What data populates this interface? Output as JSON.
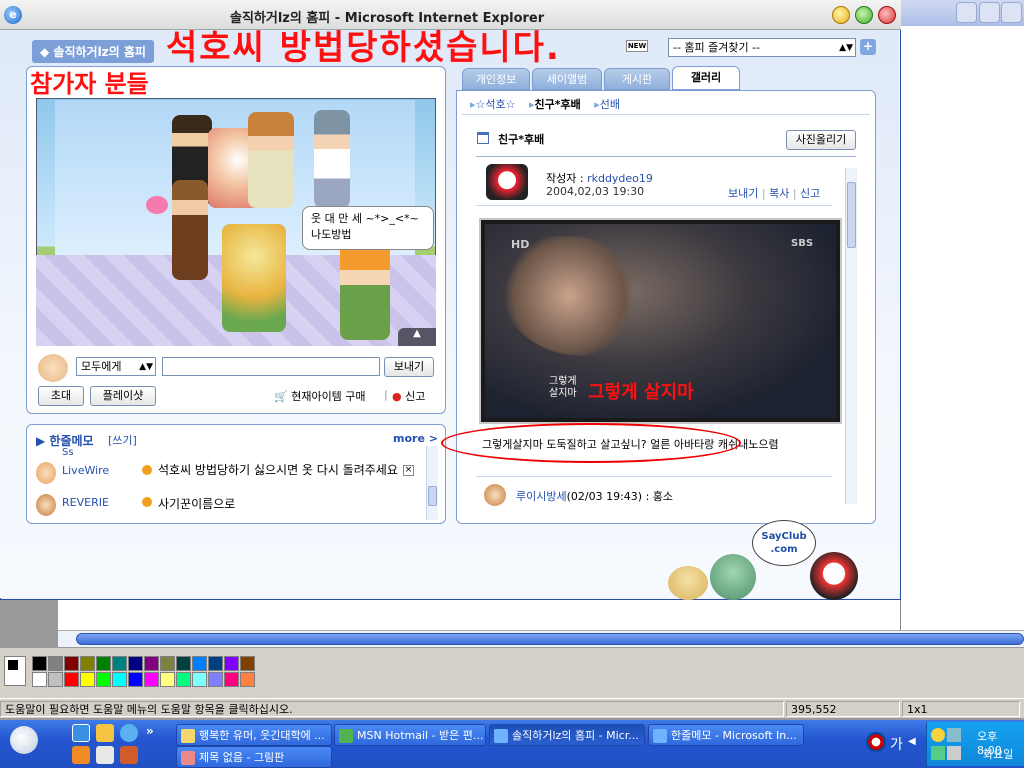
{
  "paint": {
    "status_help": "도움말이 필요하면 도움말 메뉴의 도움말 항목을 클릭하십시오.",
    "status_coords": "395,552",
    "status_size": "1x1",
    "palette": [
      "#000000",
      "#808080",
      "#800000",
      "#808000",
      "#008000",
      "#008080",
      "#000080",
      "#800080",
      "#808040",
      "#004040",
      "#0080ff",
      "#004080",
      "#8000ff",
      "#804000",
      "#ffffff",
      "#c0c0c0",
      "#ff0000",
      "#ffff00",
      "#00ff00",
      "#00ffff",
      "#0000ff",
      "#ff00ff",
      "#ffff80",
      "#00ff80",
      "#80ffff",
      "#8080ff",
      "#ff0080",
      "#ff8040"
    ]
  },
  "ie": {
    "title": "솔직하거lz의 홈피 - Microsoft Internet Explorer"
  },
  "homepage": {
    "title": "솔직하거lz의 홈피",
    "new_badge": "NEW",
    "favorites_select": "-- 홈피 즐겨찾기 --",
    "overlay_headline": "석호씨 방법당하셨습니다.",
    "overlay_participants": "참가자 분들",
    "speech": "웃 대 만 세 ~*>_<*~\n나도방법",
    "chat_target": "모두에게",
    "send_button": "보내기",
    "invite_button": "초대",
    "play_button": "플레이샷",
    "buy_items": "현재아이템 구매",
    "report": "신고",
    "memo": {
      "title": "한줄메모",
      "write": "[쓰기]",
      "more": "more >",
      "rows": [
        {
          "name": "Ss",
          "text": ""
        },
        {
          "name": "LiveWire",
          "text": "석호씨 방법당하기 싫으시면 옷 다시 돌려주세요"
        },
        {
          "name": "REVERIE",
          "text": "사기꾼이름으로"
        }
      ]
    },
    "tabs": [
      "개인정보",
      "세이앨범",
      "게시판",
      "갤러리"
    ],
    "subtabs": [
      "☆석호☆",
      "친구*후배",
      "선배"
    ],
    "gallery": {
      "section_title": "친구*후배",
      "upload_button": "사진올리기",
      "author_label": "작성자 : ",
      "author": "rkddydeo19",
      "date": "2004,02,03 19:30",
      "actions": [
        "보내기",
        "복사",
        "신고"
      ],
      "photo_overlay": "그렇게 살지마",
      "photo_caption_small": "그렇게\n살지마",
      "tv_logo_left": "HD",
      "tv_logo_right": "SBS",
      "caption": "그렇게살지마 도둑질하고 살고싶니? 얼른 아바타랑 캐쉬내노으렴",
      "comment_author": "루이시방세",
      "comment_time": "(02/03 19:43) : ",
      "comment_text": "홍소"
    },
    "sayclub_logo": "SayClub\n.com"
  },
  "taskbar": {
    "tasks": [
      "행복한 유머, 웃긴대학에 ...",
      "MSN Hotmail - 받은 편...",
      "솔직하거lz의 홈피 - Micr...",
      "한줄메모 - Microsoft In...",
      "제목 없음 - 그림판"
    ],
    "lang": "가",
    "time": "오후 8:00",
    "day": "화요일"
  }
}
